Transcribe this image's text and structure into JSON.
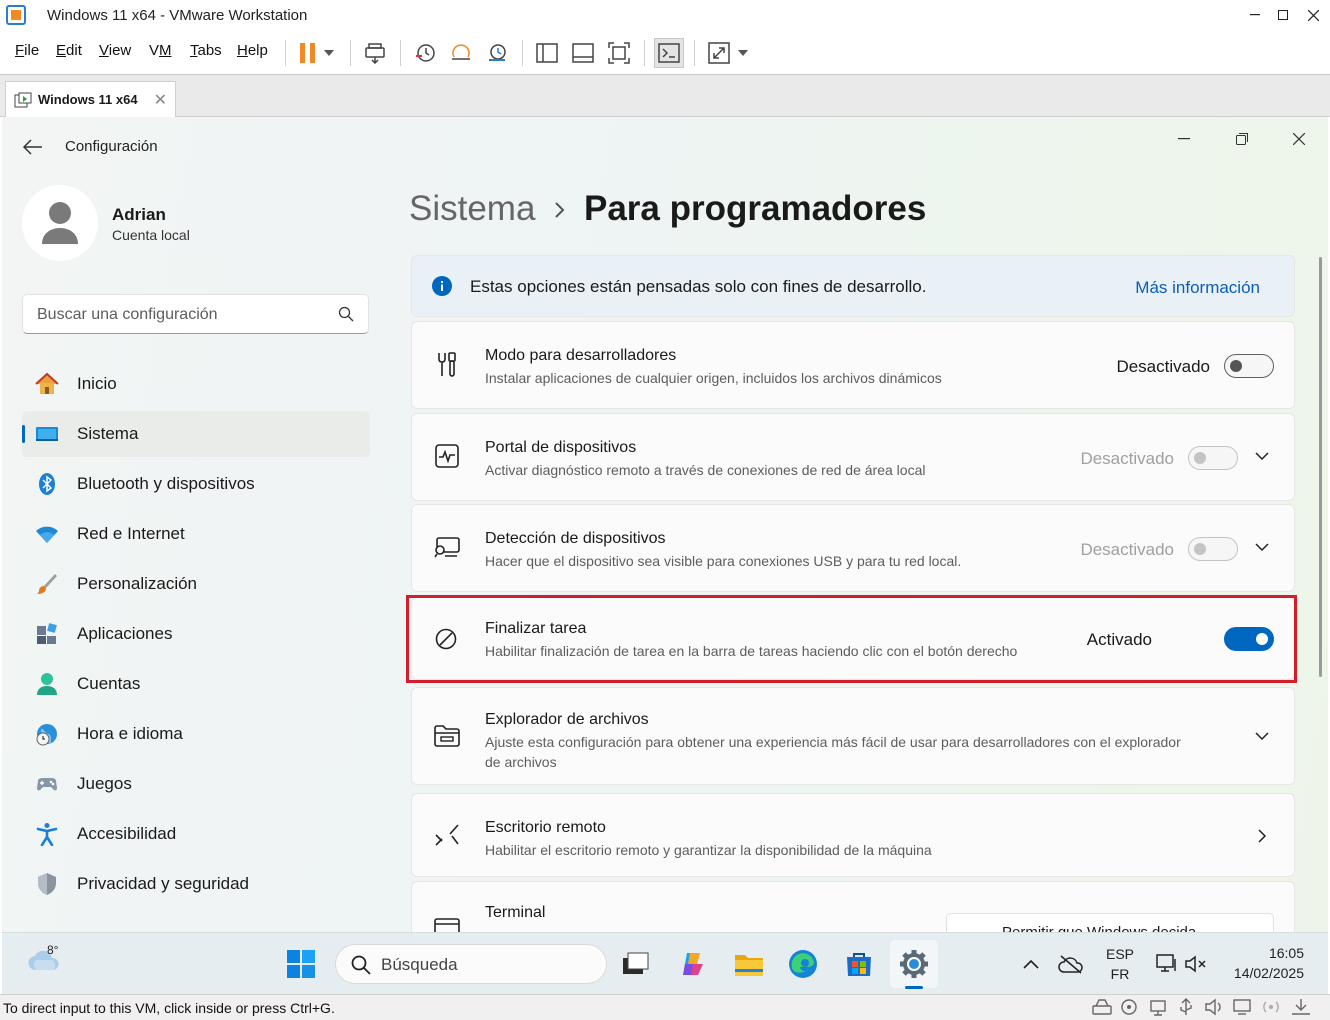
{
  "vmware": {
    "title": "Windows 11 x64 - VMware Workstation",
    "menu": [
      {
        "label": "File",
        "key": "F",
        "rest": "ile"
      },
      {
        "label": "Edit",
        "key": "E",
        "rest": "dit"
      },
      {
        "label": "View",
        "key": "V",
        "rest": "iew"
      },
      {
        "label": "VM",
        "key": "M",
        "pre": "V"
      },
      {
        "label": "Tabs",
        "key": "T",
        "rest": "abs"
      },
      {
        "label": "Help",
        "key": "H",
        "rest": "elp"
      }
    ],
    "tab": {
      "label": "Windows 11 x64",
      "close": "✕"
    },
    "status_text": "To direct input to this VM, click inside or press Ctrl+G."
  },
  "settings": {
    "window_title": "Configuración",
    "user": {
      "name": "Adrian",
      "account": "Cuenta local"
    },
    "search_placeholder": "Buscar una configuración",
    "nav": [
      {
        "label": "Inicio",
        "icon": "home-icon"
      },
      {
        "label": "Sistema",
        "icon": "system-icon",
        "selected": true
      },
      {
        "label": "Bluetooth y dispositivos",
        "icon": "bluetooth-icon"
      },
      {
        "label": "Red e Internet",
        "icon": "wifi-icon"
      },
      {
        "label": "Personalización",
        "icon": "brush-icon"
      },
      {
        "label": "Aplicaciones",
        "icon": "apps-icon"
      },
      {
        "label": "Cuentas",
        "icon": "accounts-icon"
      },
      {
        "label": "Hora e idioma",
        "icon": "time-language-icon"
      },
      {
        "label": "Juegos",
        "icon": "gamepad-icon"
      },
      {
        "label": "Accesibilidad",
        "icon": "accessibility-icon"
      },
      {
        "label": "Privacidad y seguridad",
        "icon": "shield-icon"
      }
    ],
    "breadcrumb": {
      "parent": "Sistema",
      "current": "Para programadores"
    },
    "info": {
      "text": "Estas opciones están pensadas solo con fines de desarrollo.",
      "link": "Más información"
    },
    "cards": [
      {
        "title": "Modo para desarrolladores",
        "subtitle": "Instalar aplicaciones de cualquier origen, incluidos los archivos dinámicos",
        "state": "Desactivado",
        "toggle_on": false
      },
      {
        "title": "Portal de dispositivos",
        "subtitle": "Activar diagnóstico remoto a través de conexiones de red de área local",
        "state": "Desactivado",
        "toggle_on": false
      },
      {
        "title": "Detección de dispositivos",
        "subtitle": "Hacer que el dispositivo sea visible para conexiones USB y para tu red local.",
        "state": "Desactivado",
        "toggle_on": false
      },
      {
        "title": "Finalizar tarea",
        "subtitle": "Habilitar finalización de tarea en la barra de tareas haciendo clic con el botón derecho",
        "state": "Activado",
        "toggle_on": true
      },
      {
        "title": "Explorador de archivos",
        "subtitle": "Ajuste esta configuración para obtener una experiencia más fácil de usar para desarrolladores con el explorador de archivos"
      },
      {
        "title": "Escritorio remoto",
        "subtitle": "Habilitar el escritorio remoto y garantizar la disponibilidad de la máquina"
      },
      {
        "title": "Terminal",
        "subtitle": "",
        "dropdown": "Permitir que Windows decida"
      }
    ]
  },
  "taskbar": {
    "temperature": "8°",
    "search_placeholder": "Búsqueda",
    "lang_top": "ESP",
    "lang_bottom": "FR",
    "time": "16:05",
    "date": "14/02/2025"
  },
  "colors": {
    "accent": "#0067c0",
    "highlight_border": "#d21e2a",
    "vmware_orange": "#f08a24"
  }
}
